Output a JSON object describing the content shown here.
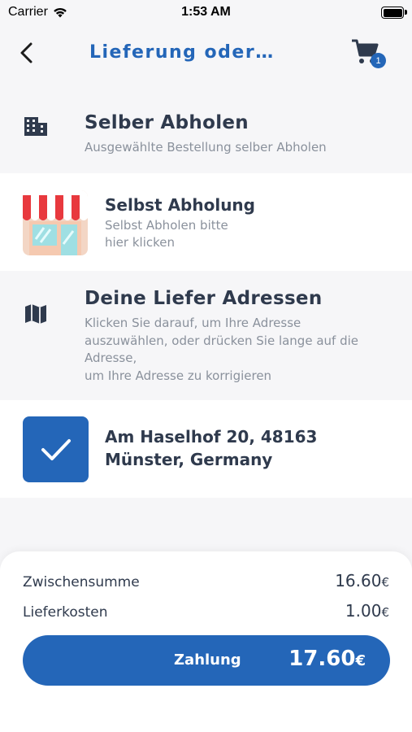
{
  "status_bar": {
    "carrier": "Carrier",
    "time": "1:53 AM",
    "battery_level": 1.0
  },
  "navbar": {
    "title": "Lieferung oder …",
    "cart_count": "1",
    "accent_color": "#2466b8"
  },
  "pickup_section": {
    "title": "Selber Abholen",
    "subtitle": "Ausgewählte Bestellung selber Abholen",
    "icon": "building-icon"
  },
  "pickup_option": {
    "title": "Selbst Abholung",
    "subtitle": "Selbst Abholen bitte\nhier klicken",
    "icon": "store-icon"
  },
  "address_section": {
    "title": "Deine Liefer Adressen",
    "subtitle": "Klicken Sie darauf, um Ihre Adresse\nauszuwählen, oder drücken Sie lange auf die\nAdresse,\num Ihre Adresse zu korrigieren",
    "icon": "map-icon"
  },
  "address_option": {
    "address": "Am Haselhof 20, 48163 Münster, Germany",
    "selected": true,
    "icon": "checkmark-icon"
  },
  "summary": {
    "subtotal_label": "Zwischensumme",
    "subtotal_value": "16.60",
    "delivery_label": "Lieferkosten",
    "delivery_value": "1.00",
    "currency": "€",
    "pay_label": "Zahlung",
    "total_value": "17.60"
  }
}
